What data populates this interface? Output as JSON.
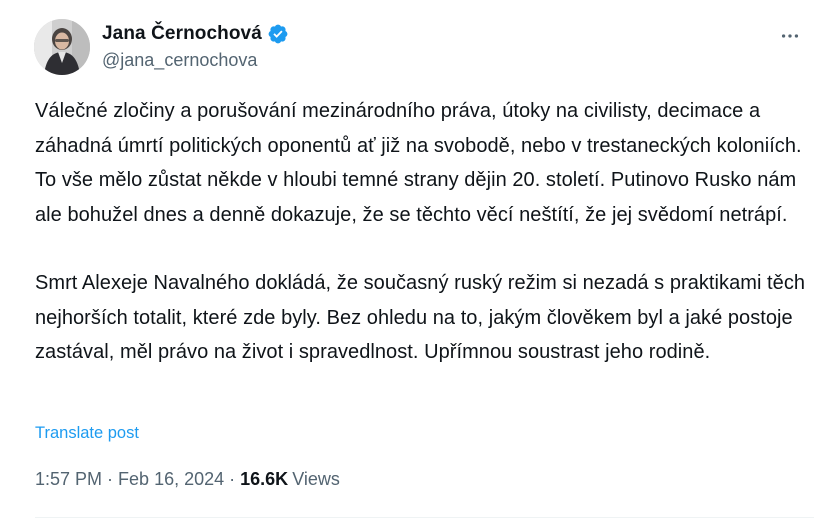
{
  "author": {
    "display_name": "Jana Černochová",
    "handle": "@jana_cernochova",
    "verified_color": "#1d9bf0"
  },
  "tweet": {
    "paragraphs": [
      "Válečné zločiny a porušování mezinárodního práva, útoky na civilisty, decimace a záhadná úmrtí politických oponentů ať již na svobodě, nebo v trestaneckých koloniích. To vše mělo zůstat někde v hloubi temné strany dějin 20. století. Putinovo Rusko nám ale bohužel dnes a denně dokazuje, že se těchto věcí neštítí, že jej svědomí netrápí.",
      "Smrt Alexeje Navalného dokládá, že současný ruský režim si nezadá s praktikami těch nejhorších totalit, které zde byly. Bez ohledu na to, jakým člověkem byl a jaké postoje zastával, měl právo na život i spravedlnost. Upřímnou soustrast jeho rodině."
    ],
    "translate_label": "Translate post"
  },
  "meta": {
    "time": "1:57 PM",
    "separator": "·",
    "date": "Feb 16, 2024",
    "views_count": "16.6K",
    "views_label": "Views"
  },
  "icons": {
    "verified": "verified-badge-icon",
    "more": "more-options-icon"
  },
  "colors": {
    "link": "#1d9bf0",
    "secondary_text": "#536471",
    "primary_text": "#0f1419"
  }
}
